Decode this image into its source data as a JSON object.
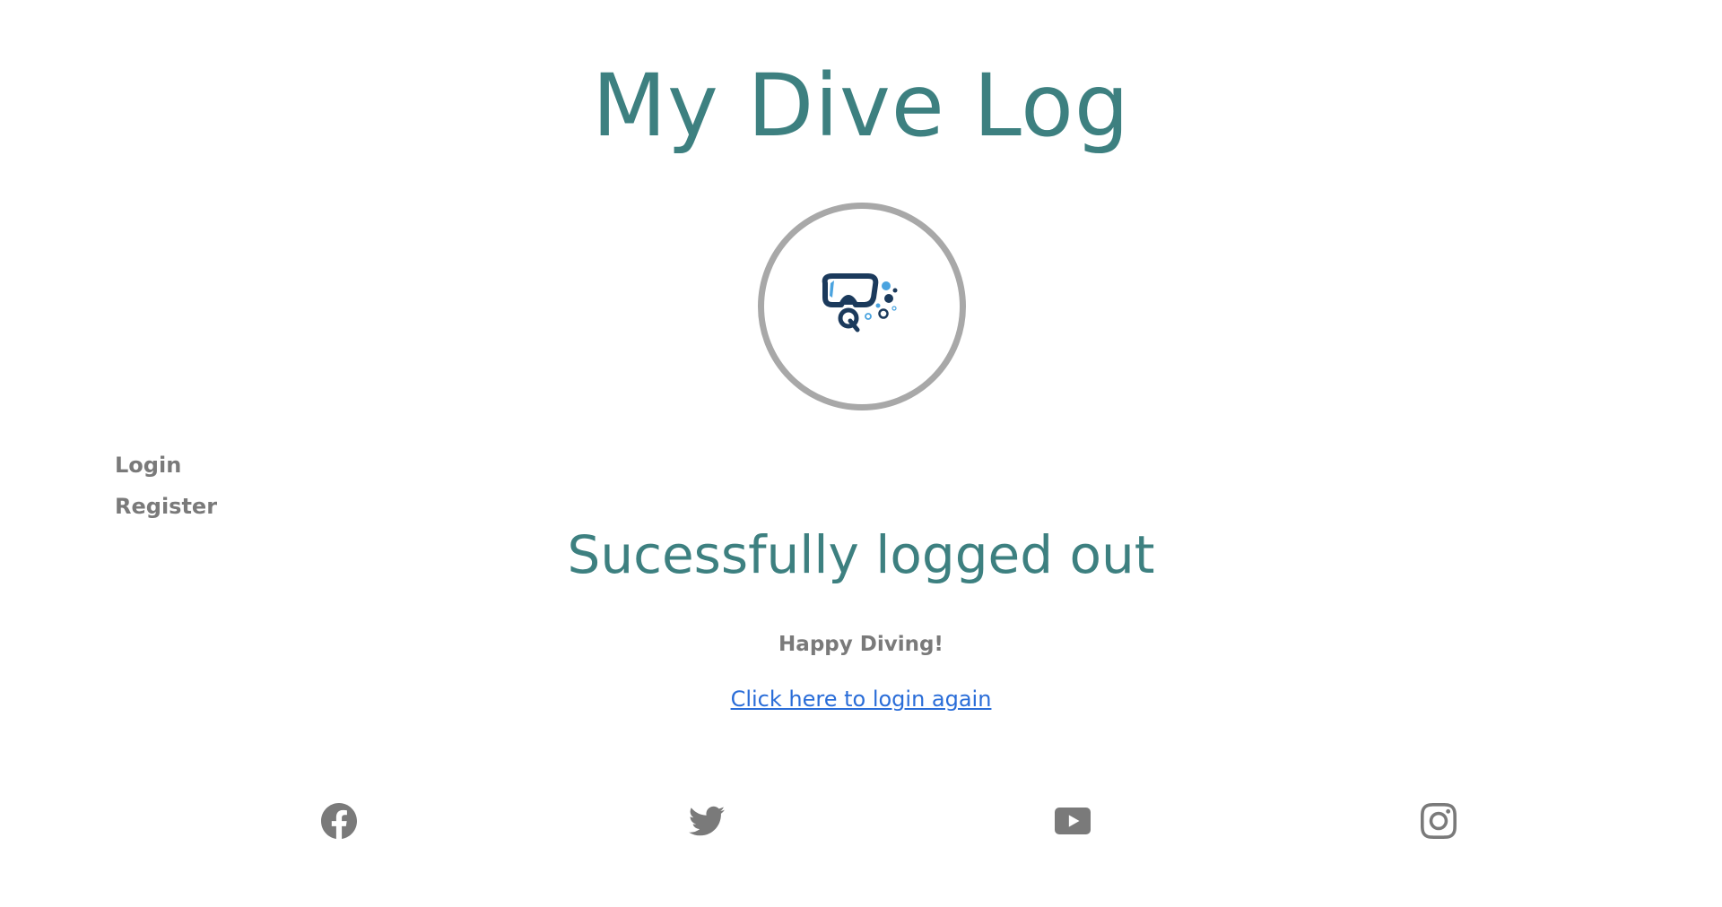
{
  "header": {
    "title": "My Dive Log"
  },
  "nav": {
    "items": [
      {
        "label": "Login"
      },
      {
        "label": "Register"
      }
    ]
  },
  "main": {
    "heading": "Sucessfully logged out",
    "message": "Happy Diving!",
    "login_link": "Click here to login again"
  },
  "footer": {
    "social": [
      {
        "icon": "facebook-icon"
      },
      {
        "icon": "twitter-icon"
      },
      {
        "icon": "youtube-icon"
      },
      {
        "icon": "instagram-icon"
      }
    ]
  },
  "colors": {
    "accent": "#3d8080",
    "nav_text": "#7a7a7a",
    "link": "#2a6dd8",
    "logo_ring": "#a8a8a8",
    "logo_navy": "#1b3a5c",
    "logo_blue": "#4aa3df"
  }
}
